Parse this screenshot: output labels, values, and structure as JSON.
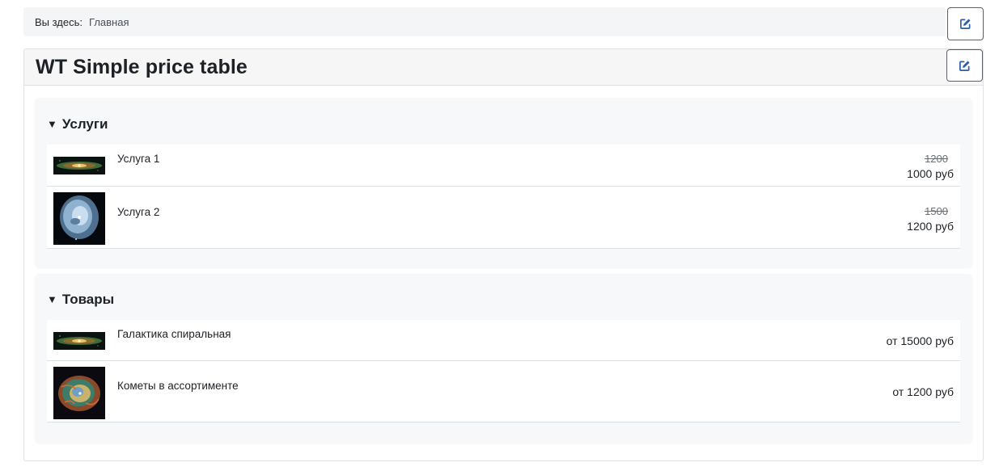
{
  "breadcrumb": {
    "prefix": "Вы здесь:",
    "home_link": "Главная"
  },
  "module": {
    "title": "WT Simple price table"
  },
  "groups": [
    {
      "title": "Услуги",
      "items": [
        {
          "name": "Услуга 1",
          "old_price": "1200",
          "price": "1000 руб",
          "image": "galaxy-thumb-icon"
        },
        {
          "name": "Услуга 2",
          "old_price": "1500",
          "price": "1200 руб",
          "image": "nebula-thumb-icon"
        }
      ]
    },
    {
      "title": "Товары",
      "items": [
        {
          "name": "Галактика спиральная",
          "price": "от 15000 руб",
          "image": "galaxy-thumb-icon"
        },
        {
          "name": "Кометы в ассортименте",
          "price": "от 1200 руб",
          "image": "crab-nebula-thumb-icon"
        }
      ]
    }
  ],
  "icons": {
    "edit": "edit-icon",
    "collapse": "triangle-down-icon"
  },
  "colors": {
    "edit_icon": "#2a5ea8",
    "panel_bg": "#f6f8fa",
    "breadcrumb_bg": "#f4f5f6"
  }
}
